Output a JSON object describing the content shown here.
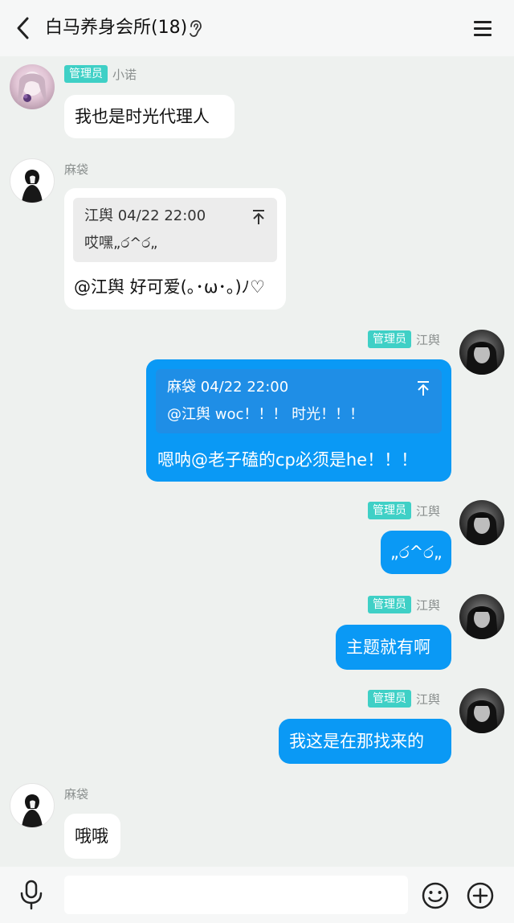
{
  "header": {
    "title": "白马养身会所(18)"
  },
  "messages": [
    {
      "sender": "小诺",
      "badge": "管理员",
      "text": "我也是时光代理人"
    },
    {
      "sender": "麻袋",
      "quote": {
        "header": "江舆 04/22 22:00",
        "body": "哎嘿„ර^ර„"
      },
      "text": "@江舆 好可爱(｡･ω･｡)ﾉ♡"
    },
    {
      "sender": "江舆",
      "badge": "管理员",
      "quote": {
        "header": "麻袋 04/22 22:00",
        "body": "@江舆 woc！！！ 时光！！！"
      },
      "text": "嗯呐@老子磕的cp必须是he！！！"
    },
    {
      "sender": "江舆",
      "badge": "管理员",
      "text": "„ර^ර„"
    },
    {
      "sender": "江舆",
      "badge": "管理员",
      "text": "主题就有啊"
    },
    {
      "sender": "江舆",
      "badge": "管理员",
      "text": "我这是在那找来的"
    },
    {
      "sender": "麻袋",
      "text": "哦哦"
    }
  ],
  "input": {
    "placeholder": ""
  },
  "icons": {
    "back": "chevron-left-icon",
    "ear": "ear-icon",
    "menu": "hamburger-menu-icon",
    "pin": "pin-to-top-icon",
    "mic": "microphone-icon",
    "emoji": "smiley-icon",
    "plus": "plus-circle-icon"
  },
  "colors": {
    "outgoing_bubble": "#0a99f5",
    "incoming_bubble": "#ffffff",
    "admin_badge": "#3fd0c6",
    "chat_background": "#eef1ef"
  }
}
